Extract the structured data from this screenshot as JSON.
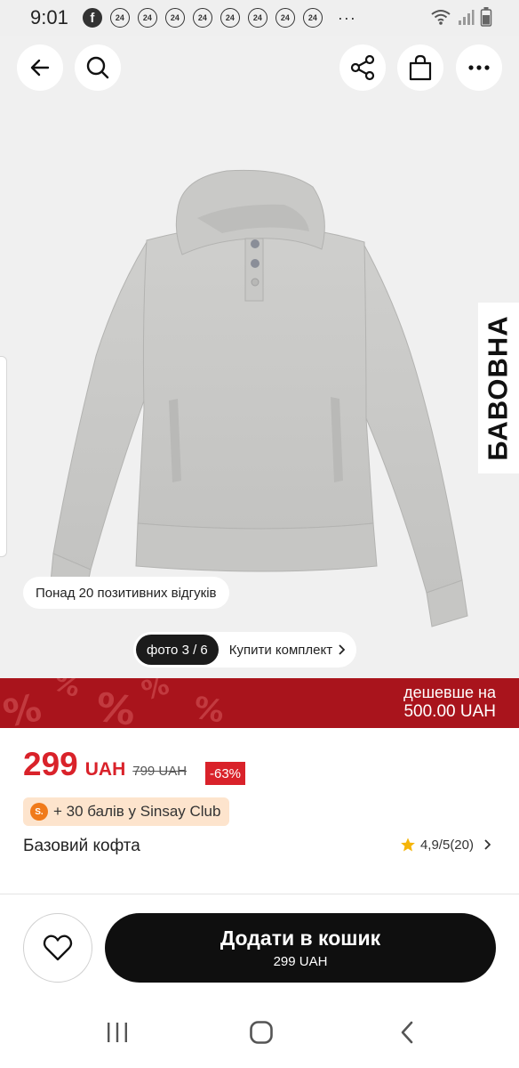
{
  "status_bar": {
    "time": "9:01",
    "notification_badges": [
      "24",
      "24",
      "24",
      "24",
      "24",
      "24",
      "24",
      "24",
      "24"
    ],
    "more_indicator": "···"
  },
  "top_bar": {
    "icons": [
      "arrow-back-icon",
      "search-icon",
      "share-icon",
      "shopping-bag-icon",
      "more-icon"
    ]
  },
  "hero": {
    "material_label": "БАВОВНА",
    "reviews_badge": "Понад 20 позитивних відгуків",
    "photo_counter": "фото 3 / 6",
    "buy_set_label": "Купити комплект"
  },
  "promo": {
    "line1": "дешевше на",
    "line2": "500.00 UAH",
    "colors": {
      "background": "#a9141c"
    }
  },
  "product": {
    "price": "299",
    "currency": "UAH",
    "old_price": "799 UAH",
    "discount": "-63%",
    "club_points": "+ 30 балів у Sinsay Club",
    "name": "Базовий кофта",
    "rating_text": "4,9/5",
    "reviews_count": "(20)",
    "colors": {
      "accent": "#d9222a",
      "star": "#f5b50a",
      "club_bg": "#fde4cd"
    }
  },
  "actions": {
    "add_to_cart": "Додати в кошик",
    "add_to_cart_price": "299 UAH"
  },
  "nav_bar": {
    "icons": [
      "recent-apps-icon",
      "home-icon",
      "back-icon"
    ]
  }
}
